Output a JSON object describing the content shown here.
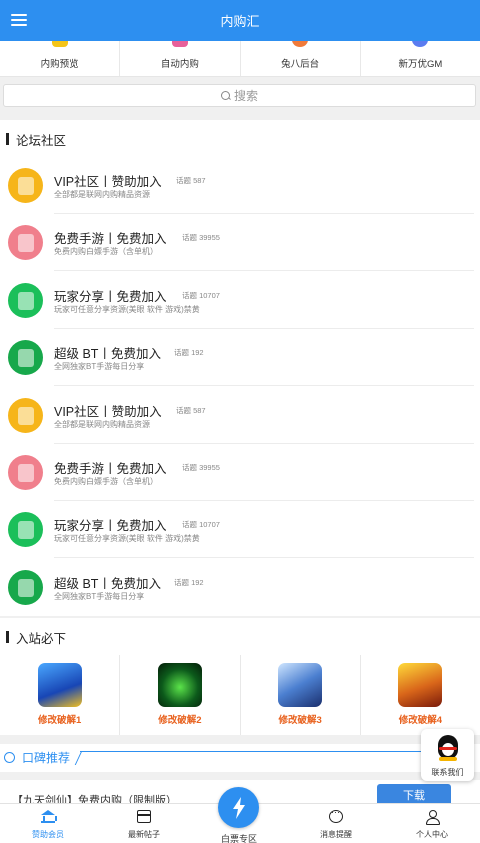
{
  "header": {
    "title": "内购汇",
    "menu_icon": "menu-icon"
  },
  "quick_links": [
    {
      "label": "内购预览",
      "icon": "crown-icon",
      "color": "#f5c518"
    },
    {
      "label": "自动内购",
      "icon": "calendar-icon",
      "color": "#e8609a"
    },
    {
      "label": "兔八后台",
      "icon": "rabbit-icon",
      "color": "#f07a3a"
    },
    {
      "label": "新万优GM",
      "icon": "gm-icon",
      "color": "#5b7cf0"
    }
  ],
  "search": {
    "placeholder": "搜索"
  },
  "forum": {
    "heading": "论坛社区",
    "items": [
      {
        "title": "VIP社区丨赞助加入",
        "count": "话题 587",
        "desc": "全部都是联网内购精品资源",
        "color": "#f6b51a"
      },
      {
        "title": "免费手游丨免费加入",
        "count": "话题 39955",
        "desc": "免费内购白嫖手游（含单机）",
        "color": "#f07f8c"
      },
      {
        "title": "玩家分享丨免费加入",
        "count": "话题 10707",
        "desc": "玩家可任意分享资源(美眼 软件 游戏)禁黄",
        "color": "#1bbf5a"
      },
      {
        "title": "超级 BT丨免费加入",
        "count": "话题 192",
        "desc": "全网独家BT手游每日分享",
        "color": "#17a84b"
      },
      {
        "title": "VIP社区丨赞助加入",
        "count": "话题 587",
        "desc": "全部都是联网内购精品资源",
        "color": "#f6b51a"
      },
      {
        "title": "免费手游丨免费加入",
        "count": "话题 39955",
        "desc": "免费内购白嫖手游（含单机）",
        "color": "#f07f8c"
      },
      {
        "title": "玩家分享丨免费加入",
        "count": "话题 10707",
        "desc": "玩家可任意分享资源(美眼 软件 游戏)禁黄",
        "color": "#1bbf5a"
      },
      {
        "title": "超级 BT丨免费加入",
        "count": "话题 192",
        "desc": "全网独家BT手游每日分享",
        "color": "#17a84b"
      }
    ]
  },
  "must_see": {
    "heading": "入站必下",
    "games": [
      {
        "label": "修改破解1"
      },
      {
        "label": "修改破解2"
      },
      {
        "label": "修改破解3"
      },
      {
        "label": "修改破解4"
      }
    ]
  },
  "recommend": {
    "heading": "口碑推荐"
  },
  "teaser": {
    "text": "【九天剑仙】免费内购（限制版）",
    "download_label": "下载"
  },
  "contact": {
    "label": "联系我们"
  },
  "tabbar": {
    "items": [
      {
        "label": "赞助会员"
      },
      {
        "label": "最新帖子"
      },
      {
        "label": "白票专区"
      },
      {
        "label": "消息提醒"
      },
      {
        "label": "个人中心"
      }
    ]
  },
  "colors": {
    "primary": "#2d8ff0",
    "game_label": "#e8621f"
  }
}
